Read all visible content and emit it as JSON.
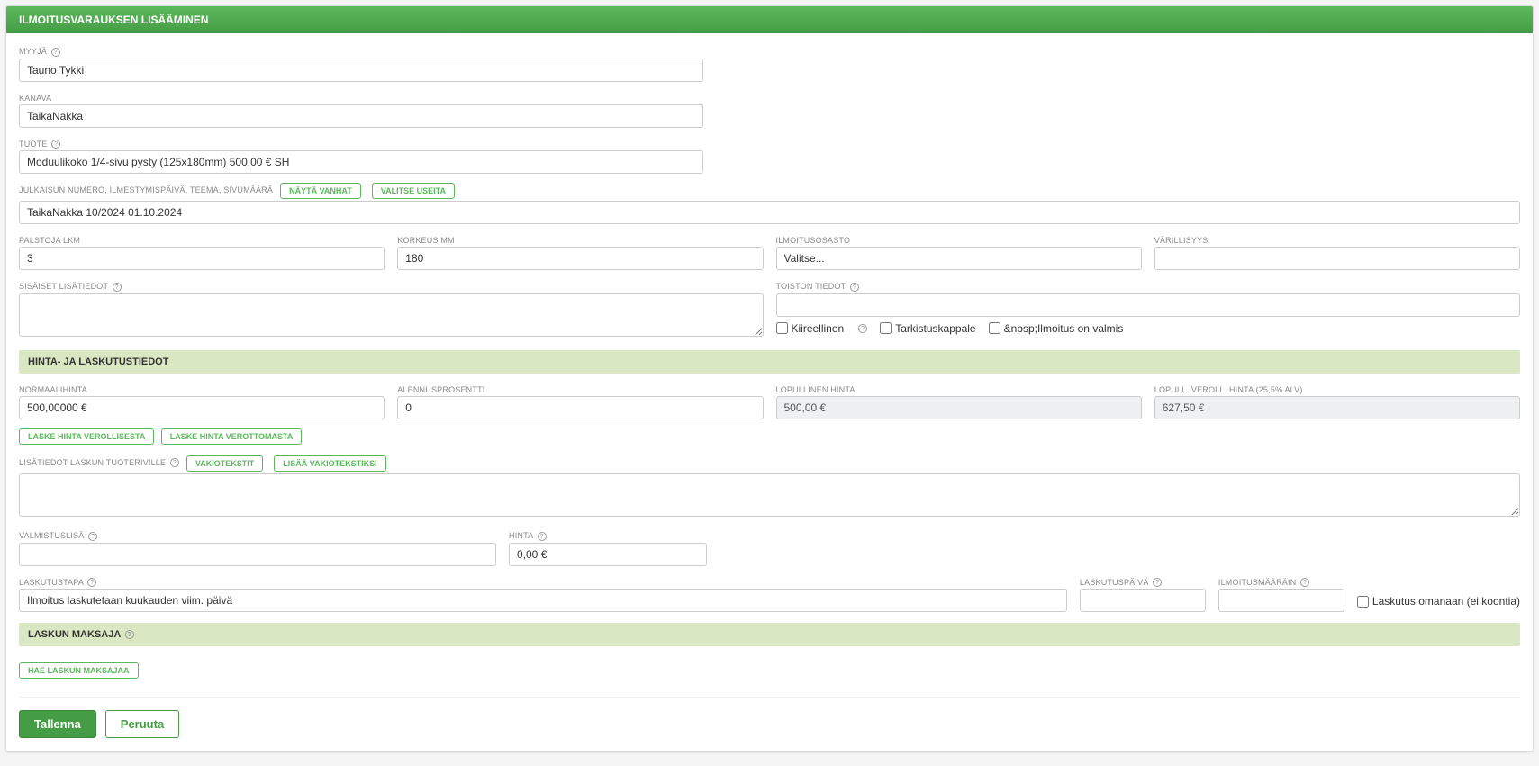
{
  "header": {
    "title": "ILMOITUSVARAUKSEN LISÄÄMINEN"
  },
  "fields": {
    "myyja": {
      "label": "MYYJÄ",
      "value": "Tauno Tykki"
    },
    "kanava": {
      "label": "KANAVA",
      "value": "TaikaNakka"
    },
    "tuote": {
      "label": "TUOTE",
      "value": "Moduulikoko 1/4-sivu pysty (125x180mm) 500,00 € SH"
    },
    "julkaisu": {
      "label": "JULKAISUN NUMERO, ILMESTYMISPÄIVÄ, TEEMA, SIVUMÄÄRÄ",
      "value": "TaikaNakka 10/2024 01.10.2024",
      "btn_vanhat": "NÄYTÄ VANHAT",
      "btn_useita": "VALITSE USEITA"
    },
    "palstoja": {
      "label": "PALSTOJA LKM",
      "value": "3"
    },
    "korkeus": {
      "label": "KORKEUS MM",
      "value": "180"
    },
    "ilmoitusosasto": {
      "label": "ILMOITUSOSASTO",
      "value": "Valitse..."
    },
    "varillisyys": {
      "label": "VÄRILLISYYS",
      "value": ""
    },
    "sisaiset": {
      "label": "SISÄISET LISÄTIEDOT",
      "value": ""
    },
    "toiston": {
      "label": "TOISTON TIEDOT",
      "value": ""
    }
  },
  "checks": {
    "kiireellinen": "Kiireellinen",
    "tarkistuskappale": "Tarkistuskappale",
    "ilmoitus_valmis": "&nbsp;Ilmoitus on valmis"
  },
  "sections": {
    "hinta": "HINTA- JA LASKUTUSTIEDOT",
    "maksaja": "LASKUN MAKSAJA"
  },
  "pricing": {
    "normaalihinta": {
      "label": "NORMAALIHINTA",
      "value": "500,00000 €"
    },
    "alennusprosentti": {
      "label": "ALENNUSPROSENTTI",
      "value": "0"
    },
    "lopullinen": {
      "label": "LOPULLINEN HINTA",
      "value": "500,00 €"
    },
    "lopull_veroll": {
      "label": "LOPULL. VEROLL. HINTA (25,5% ALV)",
      "value": "627,50 €"
    },
    "btn_verollisesta": "LASKE HINTA VEROLLISESTA",
    "btn_verottomasta": "LASKE HINTA VEROTTOMASTA",
    "lisatiedot": {
      "label": "LISÄTIEDOT LASKUN TUOTERIVILLE",
      "btn_vakio": "VAKIOTEKSTIT",
      "btn_lisaa": "LISÄÄ VAKIOTEKSTIKSI",
      "value": ""
    },
    "valmistuslisa": {
      "label": "VALMISTUSLISÄ",
      "value": ""
    },
    "hinta_field": {
      "label": "HINTA",
      "value": "0,00 €"
    },
    "laskutustapa": {
      "label": "LASKUTUSTAPA",
      "value": "Ilmoitus laskutetaan kuukauden viim. päivä"
    },
    "laskutuspaiva": {
      "label": "LASKUTUSPÄIVÄ",
      "value": ""
    },
    "ilmoitusmaarain": {
      "label": "ILMOITUSMÄÄRÄIN",
      "value": ""
    },
    "laskutus_omanaan": "Laskutus omanaan (ei koontia)"
  },
  "maksaja": {
    "btn_hae": "HAE LASKUN MAKSAJAA"
  },
  "footer": {
    "tallenna": "Tallenna",
    "peruuta": "Peruuta"
  }
}
